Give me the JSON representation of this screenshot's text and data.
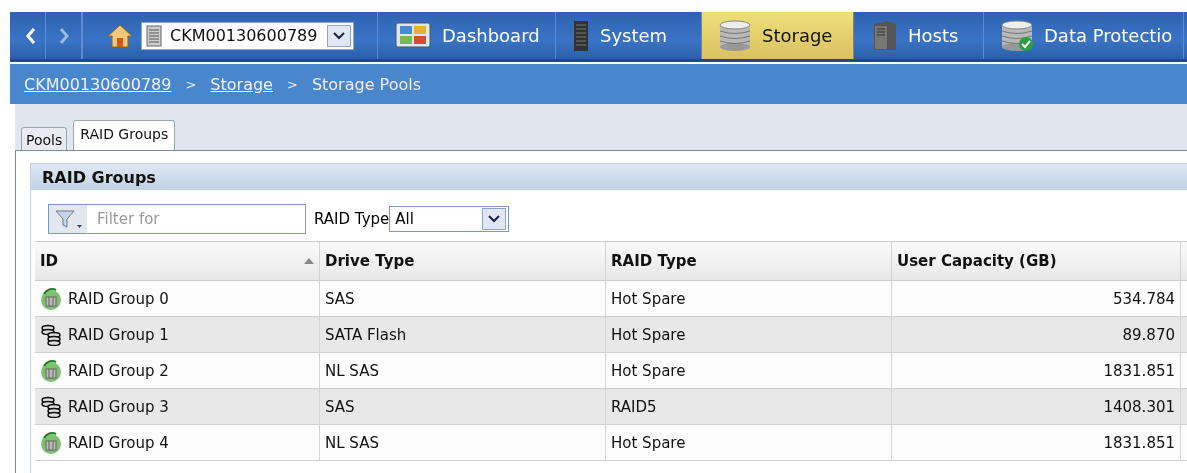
{
  "nav": {
    "system_select": {
      "value": "CKM00130600789"
    },
    "tabs": [
      {
        "label": "Dashboard",
        "selected": false
      },
      {
        "label": "System",
        "selected": false
      },
      {
        "label": "Storage",
        "selected": true
      },
      {
        "label": "Hosts",
        "selected": false
      },
      {
        "label": "Data Protectio",
        "selected": false
      }
    ]
  },
  "breadcrumb": [
    {
      "label": "CKM00130600789",
      "kind": "link"
    },
    {
      "label": ">",
      "kind": "sep"
    },
    {
      "label": "Storage",
      "kind": "link"
    },
    {
      "label": ">",
      "kind": "sep"
    },
    {
      "label": "Storage Pools",
      "kind": "current"
    }
  ],
  "tabs": [
    {
      "label": "Pools",
      "selected": false
    },
    {
      "label": "RAID Groups",
      "selected": true
    }
  ],
  "panel": {
    "title": "RAID Groups",
    "filter": {
      "placeholder": "Filter for"
    },
    "raid_type_filter": {
      "label": "RAID Type",
      "value": "All"
    }
  },
  "table": {
    "columns": [
      {
        "label": "ID",
        "sorted": true
      },
      {
        "label": "Drive Type",
        "sorted": false
      },
      {
        "label": "RAID Type",
        "sorted": false
      },
      {
        "label": "User Capacity (GB)",
        "sorted": false
      }
    ],
    "rows": [
      {
        "kind": "hot-spare",
        "cells": [
          "RAID Group 0",
          "SAS",
          "Hot Spare",
          "534.784"
        ]
      },
      {
        "kind": "raid",
        "cells": [
          "RAID Group 1",
          "SATA Flash",
          "Hot Spare",
          "89.870"
        ]
      },
      {
        "kind": "hot-spare",
        "cells": [
          "RAID Group 2",
          "NL SAS",
          "Hot Spare",
          "1831.851"
        ]
      },
      {
        "kind": "raid",
        "cells": [
          "RAID Group 3",
          "SAS",
          "RAID5",
          "1408.301"
        ]
      },
      {
        "kind": "hot-spare",
        "cells": [
          "RAID Group 4",
          "NL SAS",
          "Hot Spare",
          "1831.851"
        ]
      }
    ]
  }
}
